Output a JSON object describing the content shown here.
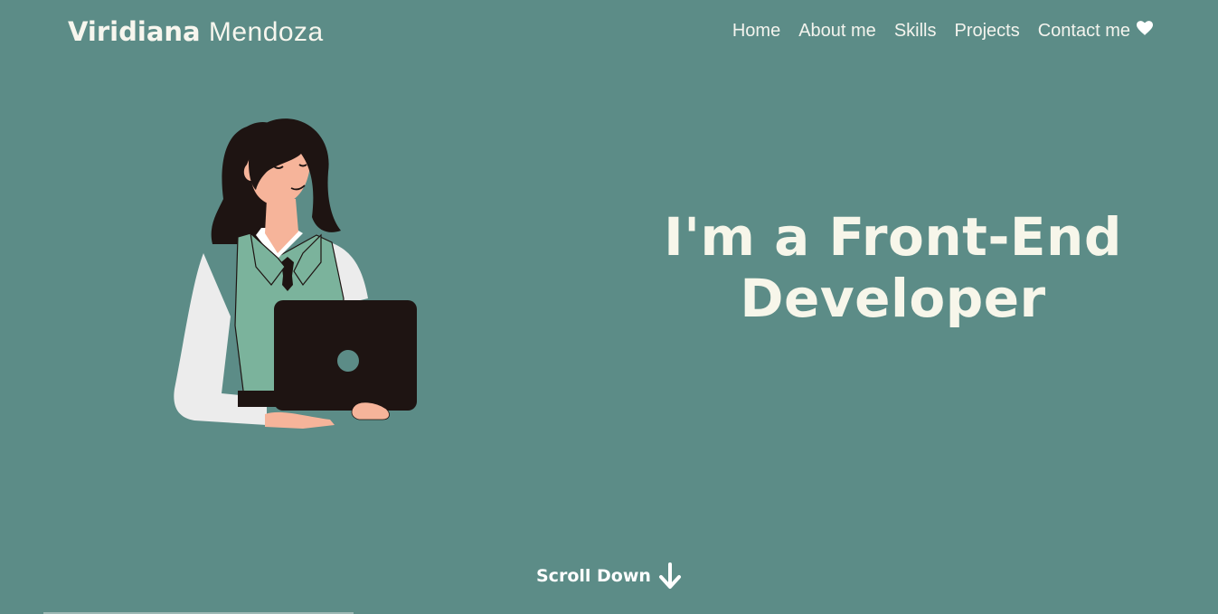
{
  "header": {
    "logo_first": "Viridiana",
    "logo_last": "Mendoza",
    "nav": [
      {
        "label": "Home"
      },
      {
        "label": "About me"
      },
      {
        "label": "Skills"
      },
      {
        "label": "Projects"
      },
      {
        "label": "Contact me"
      }
    ],
    "contact_icon": "heart-icon"
  },
  "hero": {
    "line1": "I'm a Front-End",
    "line2": "Developer"
  },
  "illustration": {
    "subject": "woman-with-laptop-illustration"
  },
  "scroll": {
    "label": "Scroll Down",
    "icon": "arrow-down-icon"
  },
  "colors": {
    "background": "#5c8c87",
    "text": "#f7f6ea",
    "vest": "#7bb39c",
    "laptop": "#1e1412"
  }
}
